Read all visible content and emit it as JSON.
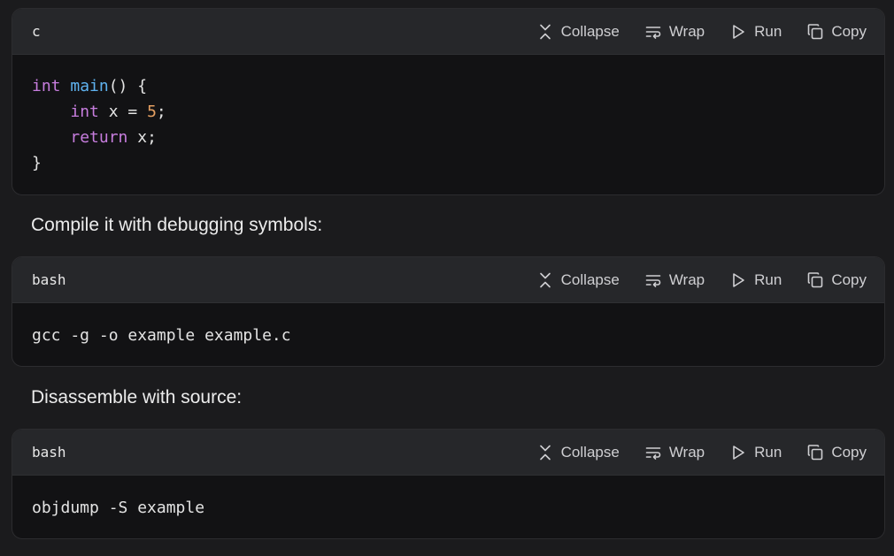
{
  "actions": {
    "collapse": "Collapse",
    "wrap": "Wrap",
    "run": "Run",
    "copy": "Copy"
  },
  "blocks": [
    {
      "lang": "c",
      "lines": [
        [
          {
            "t": "int",
            "c": "kw"
          },
          {
            "t": " "
          },
          {
            "t": "main",
            "c": "fn"
          },
          {
            "t": "() {"
          }
        ],
        [
          {
            "t": "    "
          },
          {
            "t": "int",
            "c": "kw"
          },
          {
            "t": " x = "
          },
          {
            "t": "5",
            "c": "num"
          },
          {
            "t": ";"
          }
        ],
        [
          {
            "t": "    "
          },
          {
            "t": "return",
            "c": "kw"
          },
          {
            "t": " x;"
          }
        ],
        [
          {
            "t": "}"
          }
        ]
      ]
    },
    {
      "lang": "bash",
      "lines": [
        [
          {
            "t": "gcc -g -o example example.c"
          }
        ]
      ]
    },
    {
      "lang": "bash",
      "lines": [
        [
          {
            "t": "objdump -S example"
          }
        ]
      ]
    }
  ],
  "prose": [
    "Compile it with debugging symbols:",
    "Disassemble with source:"
  ],
  "colors": {
    "keyword": "#c77dde",
    "function": "#5fb3f0",
    "number": "#e5a062",
    "background": "#1b1b1d",
    "code_bg": "#121214",
    "header_bg": "#26272a"
  },
  "icons": [
    "collapse-icon",
    "wrap-icon",
    "run-icon",
    "copy-icon"
  ]
}
